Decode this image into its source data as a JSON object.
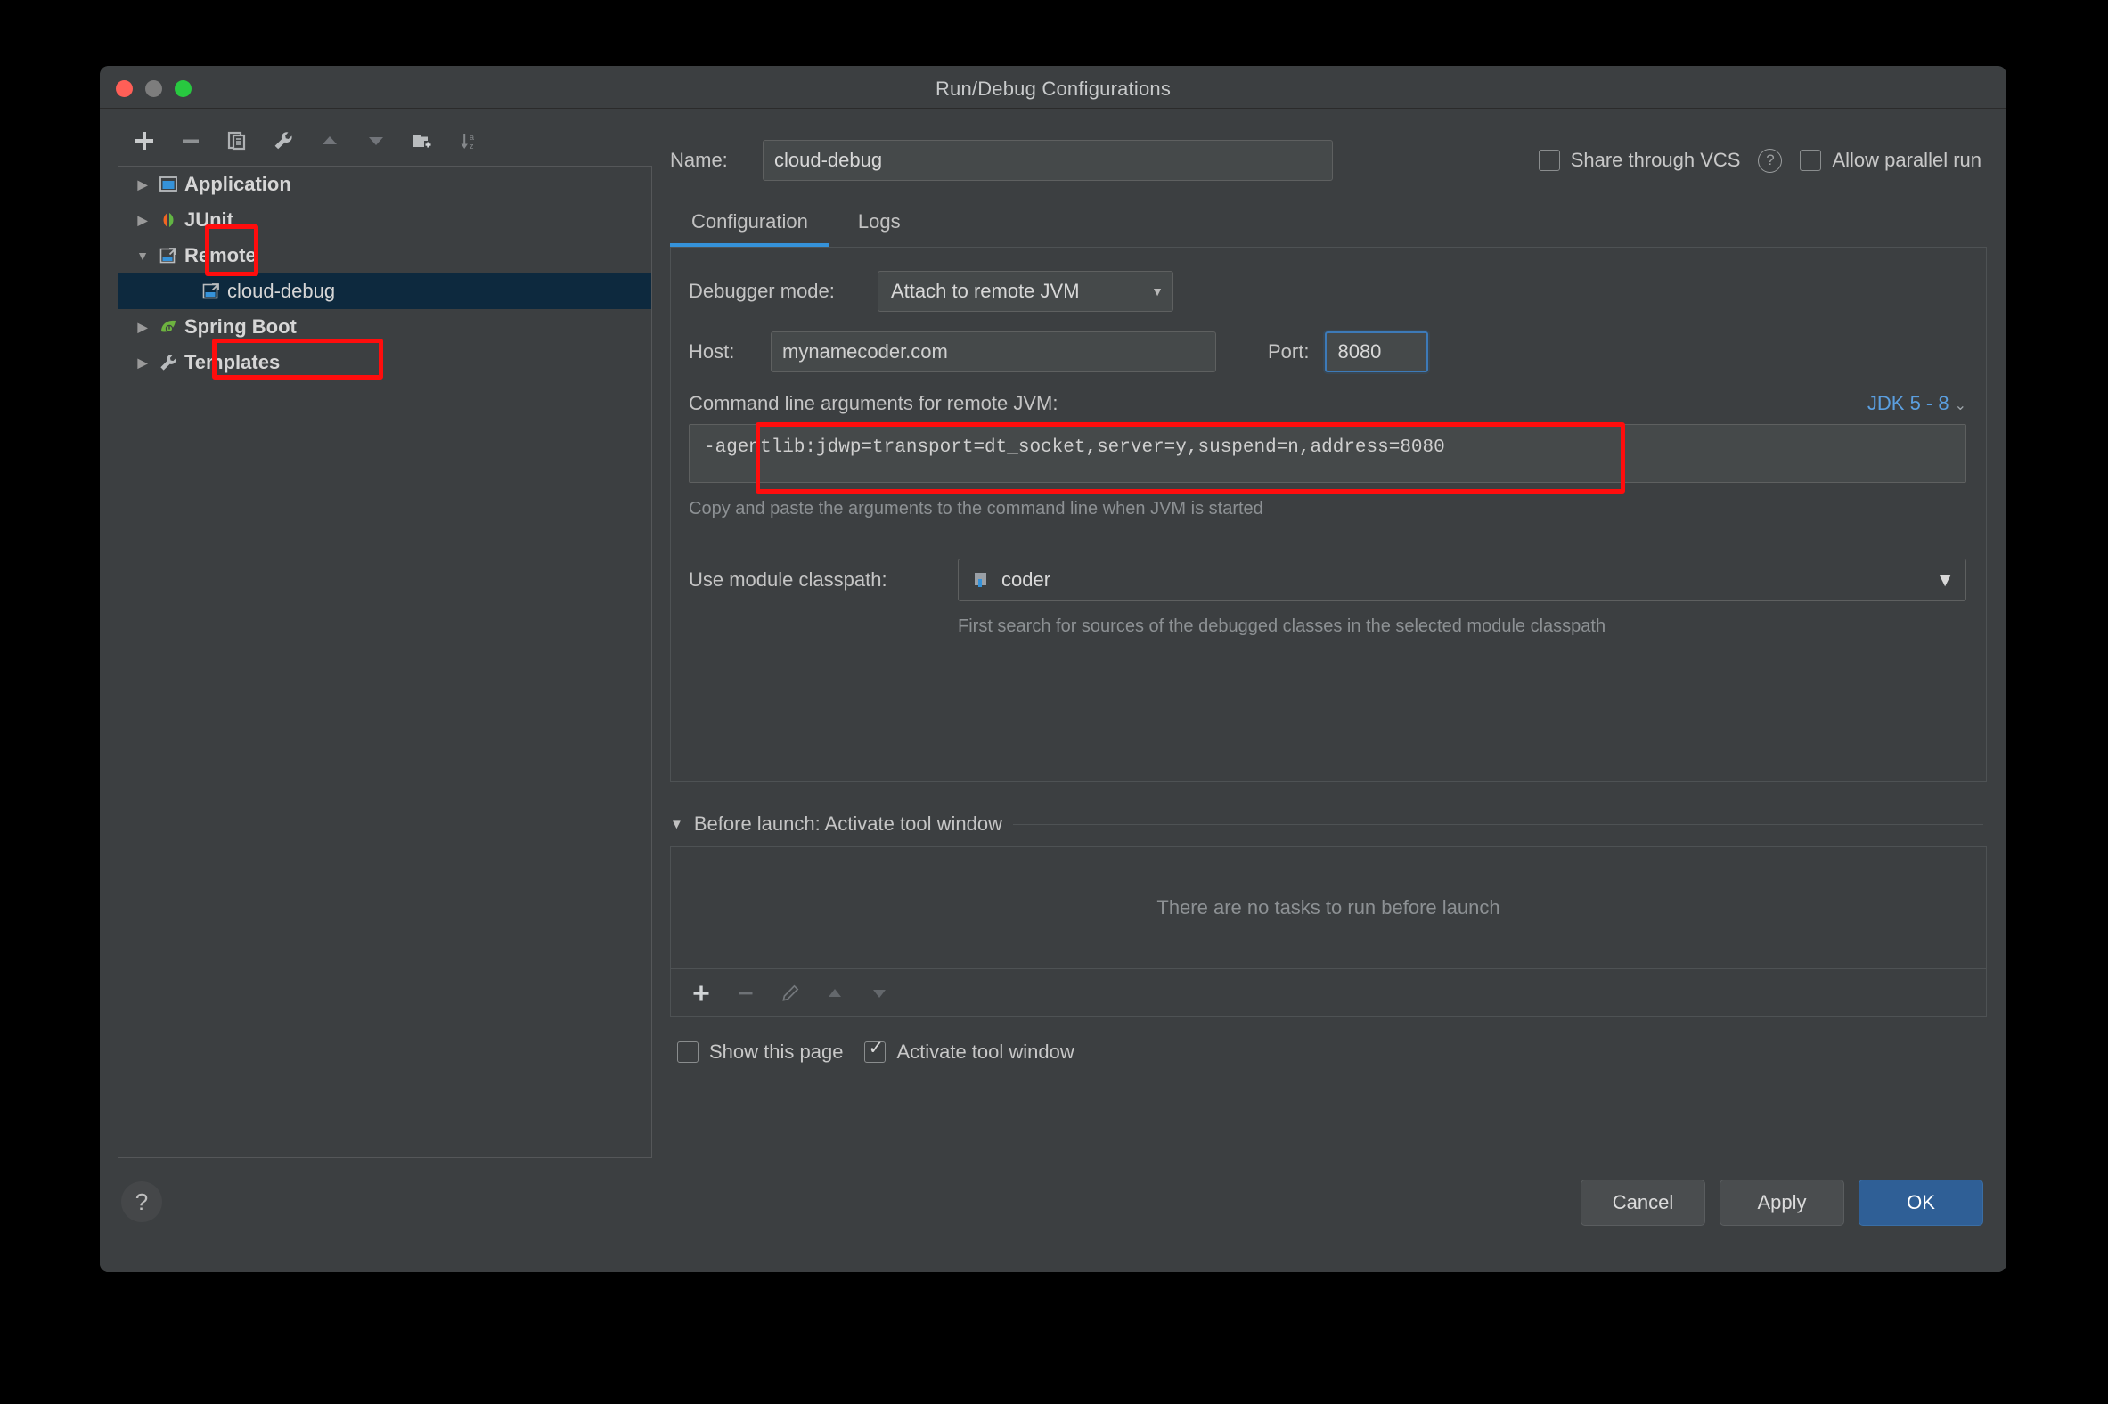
{
  "window": {
    "title": "Run/Debug Configurations",
    "traffic_lights": [
      "close-button",
      "minimize-button",
      "zoom-button"
    ]
  },
  "tree_toolbar": {
    "buttons": [
      {
        "name": "add",
        "icon": "plus-icon",
        "highlighted": true
      },
      {
        "name": "remove",
        "icon": "minus-icon"
      },
      {
        "name": "copy",
        "icon": "copy-icon"
      },
      {
        "name": "edit-templates",
        "icon": "wrench-icon"
      },
      {
        "name": "move-up",
        "icon": "arrow-up-icon"
      },
      {
        "name": "move-down",
        "icon": "arrow-down-icon"
      },
      {
        "name": "new-folder",
        "icon": "folder-add-icon"
      },
      {
        "name": "sort",
        "icon": "sort-az-icon"
      }
    ]
  },
  "tree": {
    "items": [
      {
        "label": "Application",
        "icon": "application-icon",
        "expanded": false,
        "level": 0,
        "selected": false
      },
      {
        "label": "JUnit",
        "icon": "junit-icon",
        "expanded": false,
        "level": 0,
        "selected": false
      },
      {
        "label": "Remote",
        "icon": "remote-icon",
        "expanded": true,
        "level": 0,
        "selected": false,
        "highlighted": true
      },
      {
        "label": "cloud-debug",
        "icon": "remote-icon",
        "expanded": null,
        "level": 1,
        "selected": true
      },
      {
        "label": "Spring Boot",
        "icon": "spring-boot-icon",
        "expanded": false,
        "level": 0,
        "selected": false
      },
      {
        "label": "Templates",
        "icon": "wrench-icon",
        "expanded": false,
        "level": 0,
        "selected": false
      }
    ]
  },
  "header": {
    "name_label": "Name:",
    "name_value": "cloud-debug",
    "share_vcs_label": "Share through VCS",
    "share_vcs_checked": false,
    "share_vcs_help": "?",
    "allow_parallel_label": "Allow parallel run",
    "allow_parallel_checked": false
  },
  "tabs": {
    "items": [
      {
        "label": "Configuration",
        "active": true
      },
      {
        "label": "Logs",
        "active": false
      }
    ]
  },
  "configuration": {
    "debugger_mode_label": "Debugger mode:",
    "debugger_mode_value": "Attach to remote JVM",
    "host_label": "Host:",
    "host_value": "mynamecoder.com",
    "port_label": "Port:",
    "port_value": "8080",
    "args_title": "Command line arguments for remote JVM:",
    "jdk_link": "JDK 5 - 8",
    "args_value": "-agentlib:jdwp=transport=dt_socket,server=y,suspend=n,address=8080",
    "args_hint": "Copy and paste the arguments to the command line when JVM is started",
    "module_label": "Use module classpath:",
    "module_value": "coder",
    "module_hint": "First search for sources of the debugged classes in the selected module classpath"
  },
  "before_launch": {
    "title": "Before launch: Activate tool window",
    "empty_text": "There are no tasks to run before launch",
    "toolbar": [
      {
        "name": "add-task",
        "icon": "plus-icon",
        "enabled": true
      },
      {
        "name": "remove-task",
        "icon": "minus-icon",
        "enabled": false
      },
      {
        "name": "edit-task",
        "icon": "pencil-icon",
        "enabled": false
      },
      {
        "name": "move-task-up",
        "icon": "arrow-up-icon",
        "enabled": false
      },
      {
        "name": "move-task-down",
        "icon": "arrow-down-icon",
        "enabled": false
      }
    ],
    "show_page_label": "Show this page",
    "show_page_checked": false,
    "activate_window_label": "Activate tool window",
    "activate_window_checked": true
  },
  "footer": {
    "help_label": "?",
    "cancel_label": "Cancel",
    "apply_label": "Apply",
    "ok_label": "OK"
  },
  "annotations": {
    "color": "#ff0d0d",
    "boxes": [
      "add-button-highlight",
      "remote-node-highlight",
      "host-port-highlight"
    ]
  },
  "colors": {
    "window_bg": "#3c3f41",
    "field_bg": "#45494a",
    "accent_blue": "#3592d9",
    "selection_blue": "#0d293e",
    "link_blue": "#5b9fe0",
    "ok_button": "#2f5f96",
    "annotation_red": "#ff0d0d"
  }
}
